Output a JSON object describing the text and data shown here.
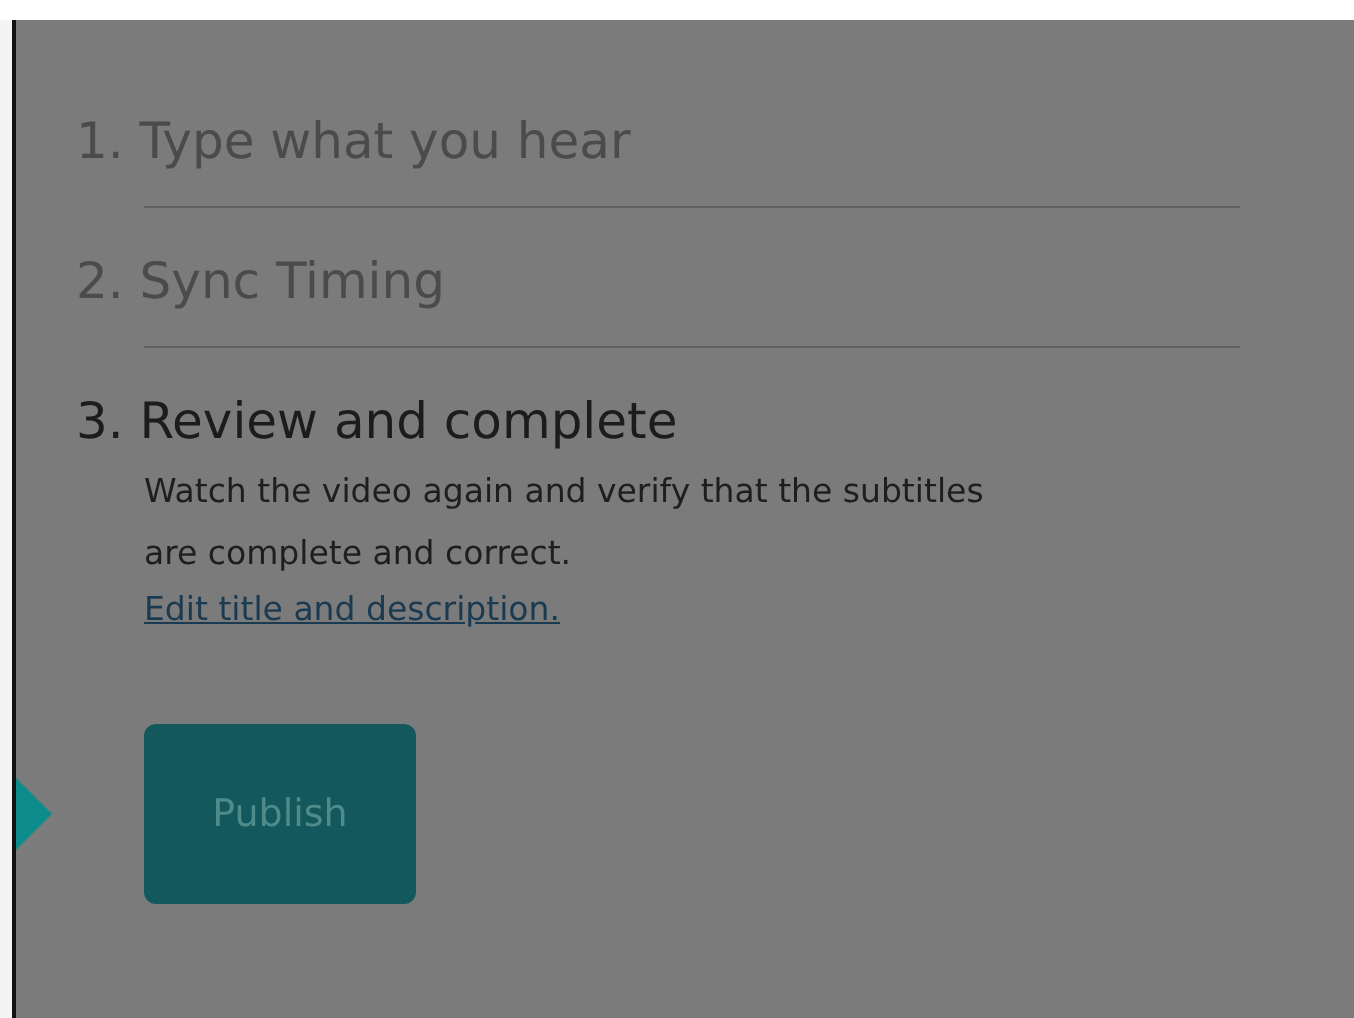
{
  "steps": [
    {
      "number": "1.",
      "title": "Type what you hear",
      "active": false
    },
    {
      "number": "2.",
      "title": "Sync Timing",
      "active": false
    },
    {
      "number": "3.",
      "title": "Review and complete",
      "active": true,
      "description": "Watch the video again and verify that the subtitles are complete and correct.",
      "link": "Edit title and description."
    }
  ],
  "button": {
    "label": "Publish",
    "disabled": true
  }
}
